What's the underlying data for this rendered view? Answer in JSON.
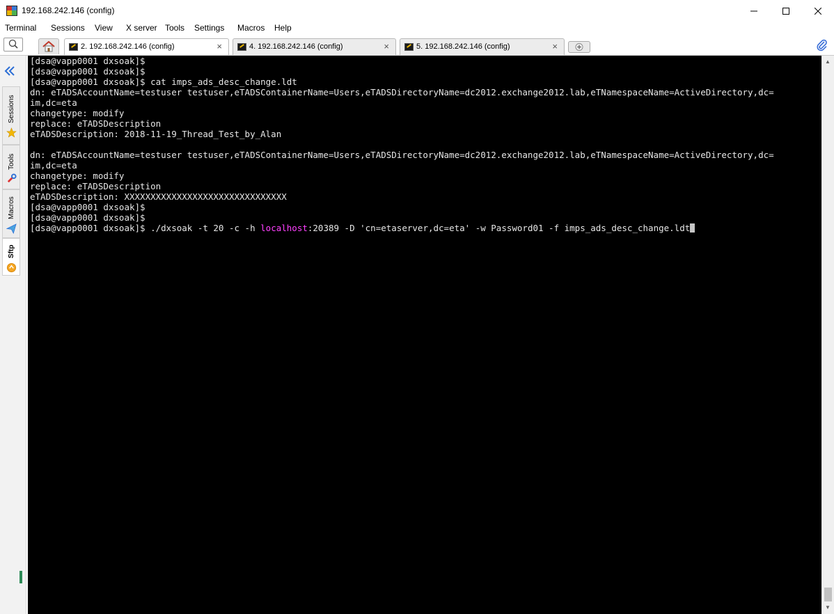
{
  "window": {
    "title": "192.168.242.146 (config)",
    "icon": "mobaxterm-app-icon"
  },
  "menu": [
    "Terminal",
    "Sessions",
    "View",
    "X server",
    "Tools",
    "Settings",
    "Macros",
    "Help"
  ],
  "tabs": [
    {
      "label": "2. 192.168.242.146 (config)",
      "close": "×",
      "active": true
    },
    {
      "label": "4. 192.168.242.146 (config)",
      "close": "×",
      "active": false
    },
    {
      "label": "5. 192.168.242.146 (config)",
      "close": "×",
      "active": false
    }
  ],
  "sidebar": {
    "tabs": [
      "Sessions",
      "Tools",
      "Macros",
      "Sftp"
    ]
  },
  "terminal": {
    "lines": [
      "[dsa@vapp0001 dxsoak]$",
      "[dsa@vapp0001 dxsoak]$",
      "[dsa@vapp0001 dxsoak]$ cat imps_ads_desc_change.ldt",
      "dn: eTADSAccountName=testuser testuser,eTADSContainerName=Users,eTADSDirectoryName=dc2012.exchange2012.lab,eTNamespaceName=ActiveDirectory,dc=",
      "im,dc=eta",
      "changetype: modify",
      "replace: eTADSDescription",
      "eTADSDescription: 2018-11-19_Thread_Test_by_Alan",
      "",
      "dn: eTADSAccountName=testuser testuser,eTADSContainerName=Users,eTADSDirectoryName=dc2012.exchange2012.lab,eTNamespaceName=ActiveDirectory,dc=",
      "im,dc=eta",
      "changetype: modify",
      "replace: eTADSDescription",
      "eTADSDescription: XXXXXXXXXXXXXXXXXXXXXXXXXXXXXXX",
      "[dsa@vapp0001 dxsoak]$",
      "[dsa@vapp0001 dxsoak]$"
    ],
    "command": {
      "prompt": "[dsa@vapp0001 dxsoak]$ ./dxsoak -t 20 -c -h ",
      "highlight": "localhost",
      "rest": ":20389 -D 'cn=etaserver,dc=eta' -w Password01 -f imps_ads_desc_change.ldt"
    },
    "colors": {
      "background": "#000000",
      "foreground": "#e6e6e6",
      "highlight": "#ff40ff"
    }
  }
}
